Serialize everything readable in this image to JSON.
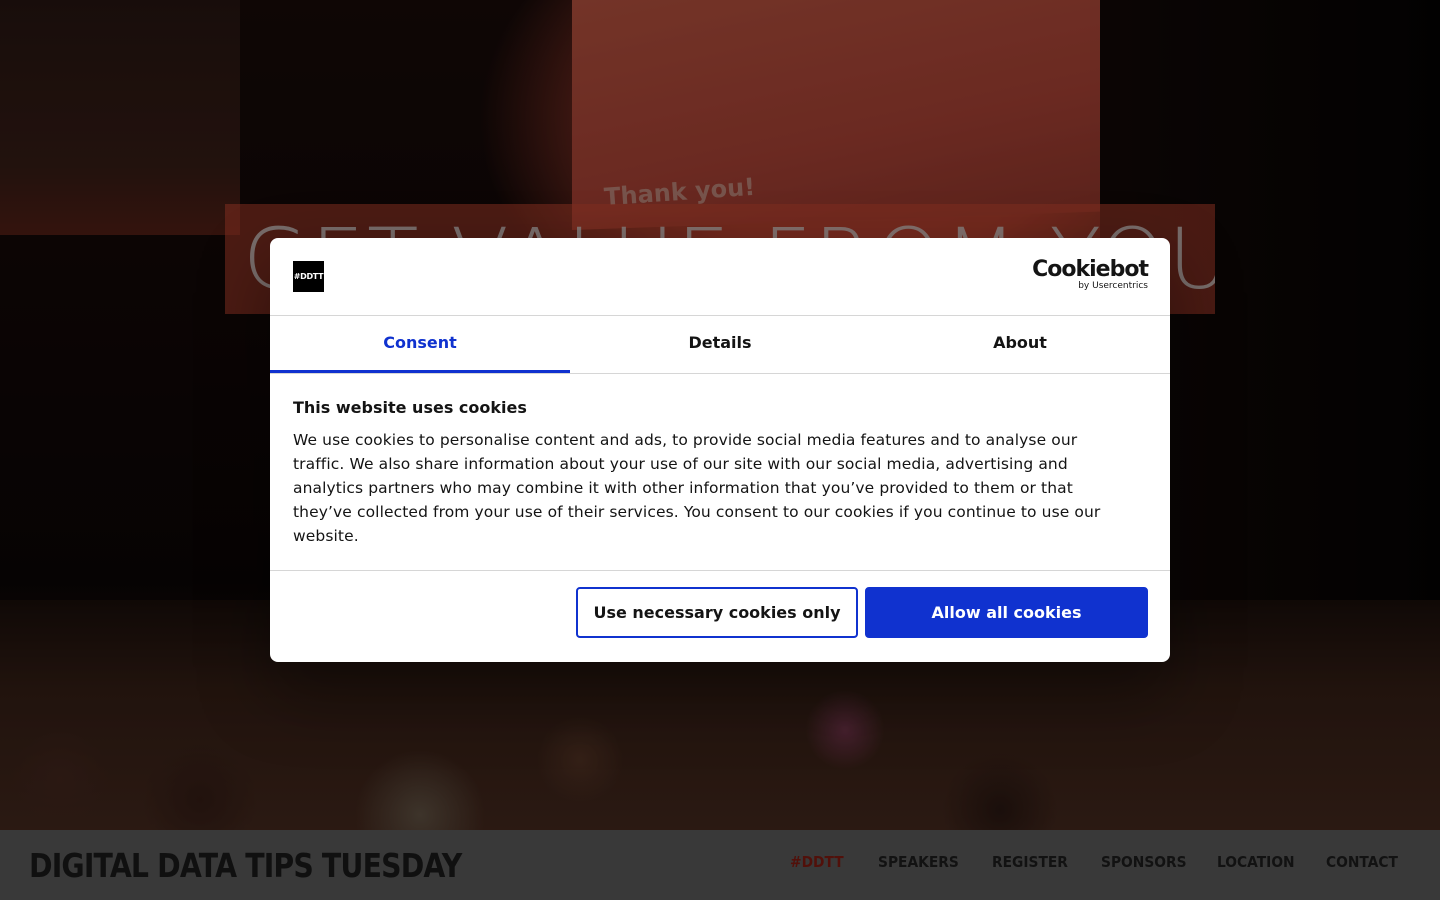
{
  "hero": {
    "screen_text": "Thank you!",
    "title": "GET VALUE FROM YOUR DATA"
  },
  "site": {
    "brand": "DIGITAL DATA TIPS TUESDAY",
    "nav": [
      "#DDTT",
      "SPEAKERS",
      "REGISTER",
      "SPONSORS",
      "LOCATION",
      "CONTACT"
    ],
    "active_nav": "#DDTT"
  },
  "cookie_dialog": {
    "logo_text": "#DDTT",
    "provider_name": "Cookiebot",
    "provider_sub": "by Usercentrics",
    "tabs": [
      "Consent",
      "Details",
      "About"
    ],
    "active_tab": "Consent",
    "title": "This website uses cookies",
    "body": "We use cookies to personalise content and ads, to provide social media features and to analyse our traffic. We also share information about your use of our site with our social media, advertising and analytics partners who may combine it with other information that you’ve provided to them or that they’ve collected from your use of their services. You consent to our cookies if you continue to use our website.",
    "buttons": {
      "necessary": "Use necessary cookies only",
      "allow_all": "Allow all cookies"
    }
  },
  "colors": {
    "accent": "#1032cf",
    "nav_active": "#8c1d12",
    "navbar_bg": "#636363"
  }
}
